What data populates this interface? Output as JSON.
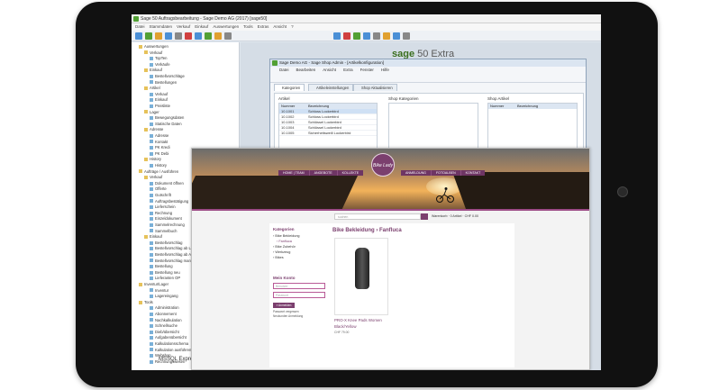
{
  "sage": {
    "title": "Sage 50 Auftragsbearbeitung - Sage Demo AG (2017) [sage50]",
    "menu": [
      "Datei",
      "Stammdaten",
      "Verkauf",
      "Einkauf",
      "Auswertungen",
      "Tools",
      "Extras",
      "Ansicht",
      "?"
    ],
    "status": "MSSQL Express 2012",
    "brand_bold": "sage",
    "brand_light": " 50 Extra",
    "tree": [
      {
        "label": "Auswertungen",
        "indent": 1,
        "folder": true
      },
      {
        "label": "Verkauf",
        "indent": 2,
        "folder": true
      },
      {
        "label": "TopTen",
        "indent": 3,
        "folder": false
      },
      {
        "label": "Verkäufe",
        "indent": 3,
        "folder": false
      },
      {
        "label": "Einkauf",
        "indent": 2,
        "folder": true
      },
      {
        "label": "Bestellvorschläge",
        "indent": 3,
        "folder": false
      },
      {
        "label": "Bestellungen",
        "indent": 3,
        "folder": false
      },
      {
        "label": "Artikel",
        "indent": 2,
        "folder": true
      },
      {
        "label": "Verkauf",
        "indent": 3,
        "folder": false
      },
      {
        "label": "Einkauf",
        "indent": 3,
        "folder": false
      },
      {
        "label": "Preisliste",
        "indent": 3,
        "folder": false
      },
      {
        "label": "Lager",
        "indent": 2,
        "folder": true
      },
      {
        "label": "Bewegungsdaten",
        "indent": 3,
        "folder": false
      },
      {
        "label": "Statische Daten",
        "indent": 3,
        "folder": false
      },
      {
        "label": "Adresse",
        "indent": 2,
        "folder": true
      },
      {
        "label": "Adresse",
        "indent": 3,
        "folder": false
      },
      {
        "label": "Kontakt",
        "indent": 3,
        "folder": false
      },
      {
        "label": "PK Kredi",
        "indent": 3,
        "folder": false
      },
      {
        "label": "PK Debi",
        "indent": 3,
        "folder": false
      },
      {
        "label": "History",
        "indent": 2,
        "folder": true
      },
      {
        "label": "History",
        "indent": 3,
        "folder": false
      },
      {
        "label": "Aufträge / Ausführen",
        "indent": 1,
        "folder": true
      },
      {
        "label": "Verkauf",
        "indent": 2,
        "folder": true
      },
      {
        "label": "Dokument öffnen",
        "indent": 3,
        "folder": false
      },
      {
        "label": "Offerte",
        "indent": 3,
        "folder": false
      },
      {
        "label": "Gutschrift",
        "indent": 3,
        "folder": false
      },
      {
        "label": "Auftragsbestätigung",
        "indent": 3,
        "folder": false
      },
      {
        "label": "Lieferschein",
        "indent": 3,
        "folder": false
      },
      {
        "label": "Rechnung",
        "indent": 3,
        "folder": false
      },
      {
        "label": "Einzeldokument",
        "indent": 3,
        "folder": false
      },
      {
        "label": "Sammelrechnung",
        "indent": 3,
        "folder": false
      },
      {
        "label": "Sammelbuch",
        "indent": 3,
        "folder": false
      },
      {
        "label": "Einkauf",
        "indent": 2,
        "folder": true
      },
      {
        "label": "Bestellvorschlag",
        "indent": 3,
        "folder": false
      },
      {
        "label": "Bestellvorschlag ab Lager",
        "indent": 3,
        "folder": false
      },
      {
        "label": "Bestellvorschlag ab Auftr.",
        "indent": 3,
        "folder": false
      },
      {
        "label": "Bestellvorschlag manuell",
        "indent": 3,
        "folder": false
      },
      {
        "label": "Bestellung",
        "indent": 3,
        "folder": false
      },
      {
        "label": "Bestellung neu",
        "indent": 3,
        "folder": false
      },
      {
        "label": "Lieferanten OP",
        "indent": 3,
        "folder": false
      },
      {
        "label": "Inventur/Lager",
        "indent": 1,
        "folder": true
      },
      {
        "label": "Inventur",
        "indent": 3,
        "folder": false
      },
      {
        "label": "Lagereingang",
        "indent": 3,
        "folder": false
      },
      {
        "label": "Tools",
        "indent": 1,
        "folder": true
      },
      {
        "label": "Administration",
        "indent": 3,
        "folder": false
      },
      {
        "label": "Abonnement",
        "indent": 3,
        "folder": false
      },
      {
        "label": "Nachkalkulation",
        "indent": 3,
        "folder": false
      },
      {
        "label": "Schnellsuche",
        "indent": 3,
        "folder": false
      },
      {
        "label": "Dieb/übersicht",
        "indent": 3,
        "folder": false
      },
      {
        "label": "Aufgabenübersicht",
        "indent": 3,
        "folder": false
      },
      {
        "label": "Kalkulationsschema",
        "indent": 3,
        "folder": false
      },
      {
        "label": "Kalkulation ausführen",
        "indent": 3,
        "folder": false
      },
      {
        "label": "Webshop",
        "indent": 3,
        "folder": false
      },
      {
        "label": "Rechnungswesen",
        "indent": 3,
        "folder": false
      }
    ]
  },
  "shopadmin": {
    "title": "Sage Demo AG - Sage Shop Admin - [Artikelkonfiguration]",
    "menu": [
      "Datei",
      "Bearbeiten",
      "Ansicht",
      "Extra",
      "Fenster",
      "Hilfe"
    ],
    "tabs": [
      "Kategorien",
      "Artikeleinstellungen",
      "Shop Aktualisieren"
    ],
    "artikel_label": "Artikel",
    "shop_kategorien_label": "Shop Kategorien",
    "shop_artikel_label": "Shop Artikel",
    "grid_head": [
      "Nummer",
      "Bezeichnung"
    ],
    "rows": [
      {
        "nr": "10.1001",
        "name": "Schloss Lockerbird"
      },
      {
        "nr": "10.1002",
        "name": "Schloss Lockerbird"
      },
      {
        "nr": "10.1003",
        "name": "Schlüssel Lockerbird"
      },
      {
        "nr": "10.1004",
        "name": "Schlüssel Lockerbird"
      },
      {
        "nr": "10.1005",
        "name": "Sicherheitsweill Lockerbird"
      }
    ]
  },
  "webshop": {
    "logo": "Bike Lady",
    "nav_left": [
      "HOME | TEAM",
      "ANGEBOTE",
      "KOLLEKTE"
    ],
    "nav_right": [
      "ANMELDUNG",
      "FOTOALBEN",
      "KONTAKT"
    ],
    "search_placeholder": "suchen",
    "cart": "Warenkorb · 0 Artikel · CHF 0.00",
    "categories_title": "Kategorien",
    "categories": [
      {
        "label": "› Bike Bekleidung",
        "sub": false
      },
      {
        "label": "› Fanfluca",
        "sub": true
      },
      {
        "label": "› Bike Zubehör",
        "sub": false
      },
      {
        "label": "› Werkzeug",
        "sub": false
      },
      {
        "label": "› Bikes",
        "sub": false
      }
    ],
    "account_title": "Mein Konto",
    "username_placeholder": "Benutzer",
    "password_placeholder": "Passwort",
    "login_label": "» Anmelden",
    "forgot_link": "Passwort vergessen",
    "register_link": "Neukunden Anmeldung",
    "breadcrumb": "Bike Bekleidung › Fanfluca",
    "product_name": "PRO-X Knee Pads Women Black/Yellow",
    "product_price": "CHF 79.00"
  }
}
